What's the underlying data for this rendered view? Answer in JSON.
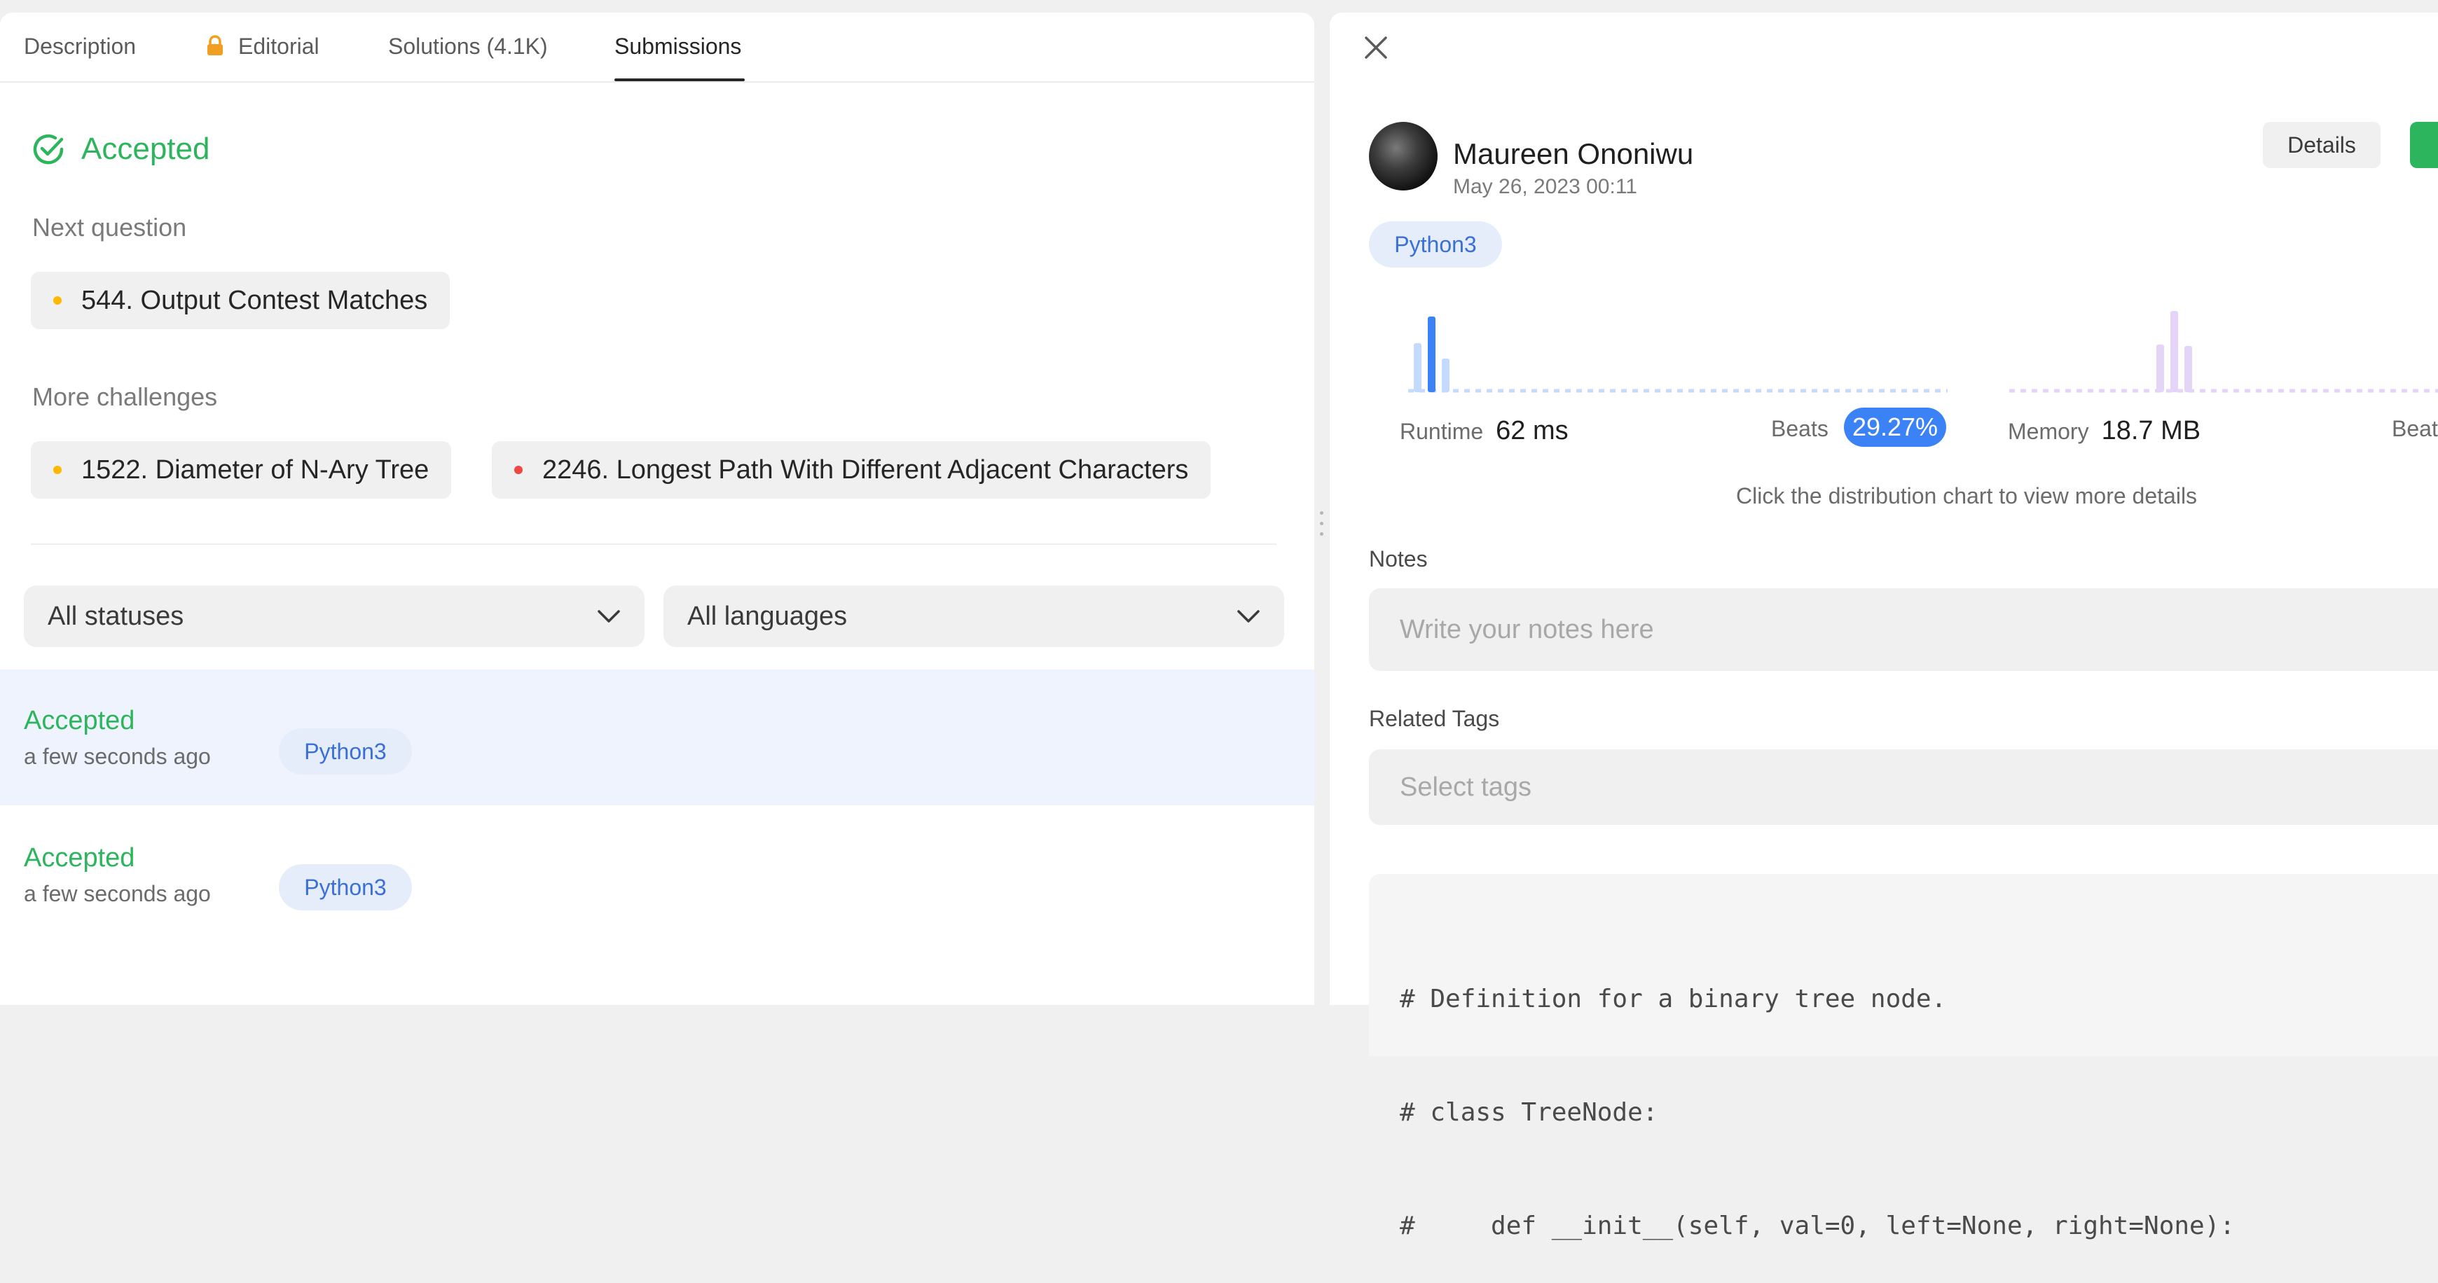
{
  "tabs": [
    {
      "label": "Description"
    },
    {
      "label": "Editorial",
      "icon": "lock-icon"
    },
    {
      "label": "Solutions (4.1K)"
    },
    {
      "label": "Submissions",
      "active": true
    }
  ],
  "result": {
    "status": "Accepted"
  },
  "next_question": {
    "label": "Next question",
    "item": {
      "title": "544. Output Contest Matches",
      "difficulty_color": "#ffb800"
    }
  },
  "more_challenges": {
    "label": "More challenges",
    "items": [
      {
        "title": "1522. Diameter of N-Ary Tree",
        "difficulty_color": "#ffb800"
      },
      {
        "title": "2246. Longest Path With Different Adjacent Characters",
        "difficulty_color": "#ef4743"
      }
    ]
  },
  "filters": {
    "status": "All statuses",
    "language": "All languages"
  },
  "submissions": [
    {
      "status": "Accepted",
      "time": "a few seconds ago",
      "language": "Python3"
    },
    {
      "status": "Accepted",
      "time": "a few seconds ago",
      "language": "Python3"
    }
  ],
  "detail": {
    "user_name": "Maureen Ononiwu",
    "date": "May 26, 2023 00:11",
    "details_button": "Details",
    "language": "Python3",
    "runtime": {
      "label": "Runtime",
      "value": "62 ms",
      "beats_label": "Beats",
      "beats_value": "29.27%"
    },
    "memory": {
      "label": "Memory",
      "value": "18.7 MB",
      "beats_label": "Beat"
    },
    "hint": "Click the distribution chart to view more details",
    "notes": {
      "label": "Notes",
      "placeholder": "Write your notes here"
    },
    "tags": {
      "label": "Related Tags",
      "placeholder": "Select tags"
    },
    "code_lines": [
      "# Definition for a binary tree node.",
      "# class TreeNode:",
      "#     def __init__(self, val=0, left=None, right=None):"
    ]
  },
  "colors": {
    "accent_green": "#2db55d",
    "accent_blue": "#3b82f6",
    "language_pill_bg": "#e5edfb",
    "language_pill_text": "#3b6fd8"
  }
}
